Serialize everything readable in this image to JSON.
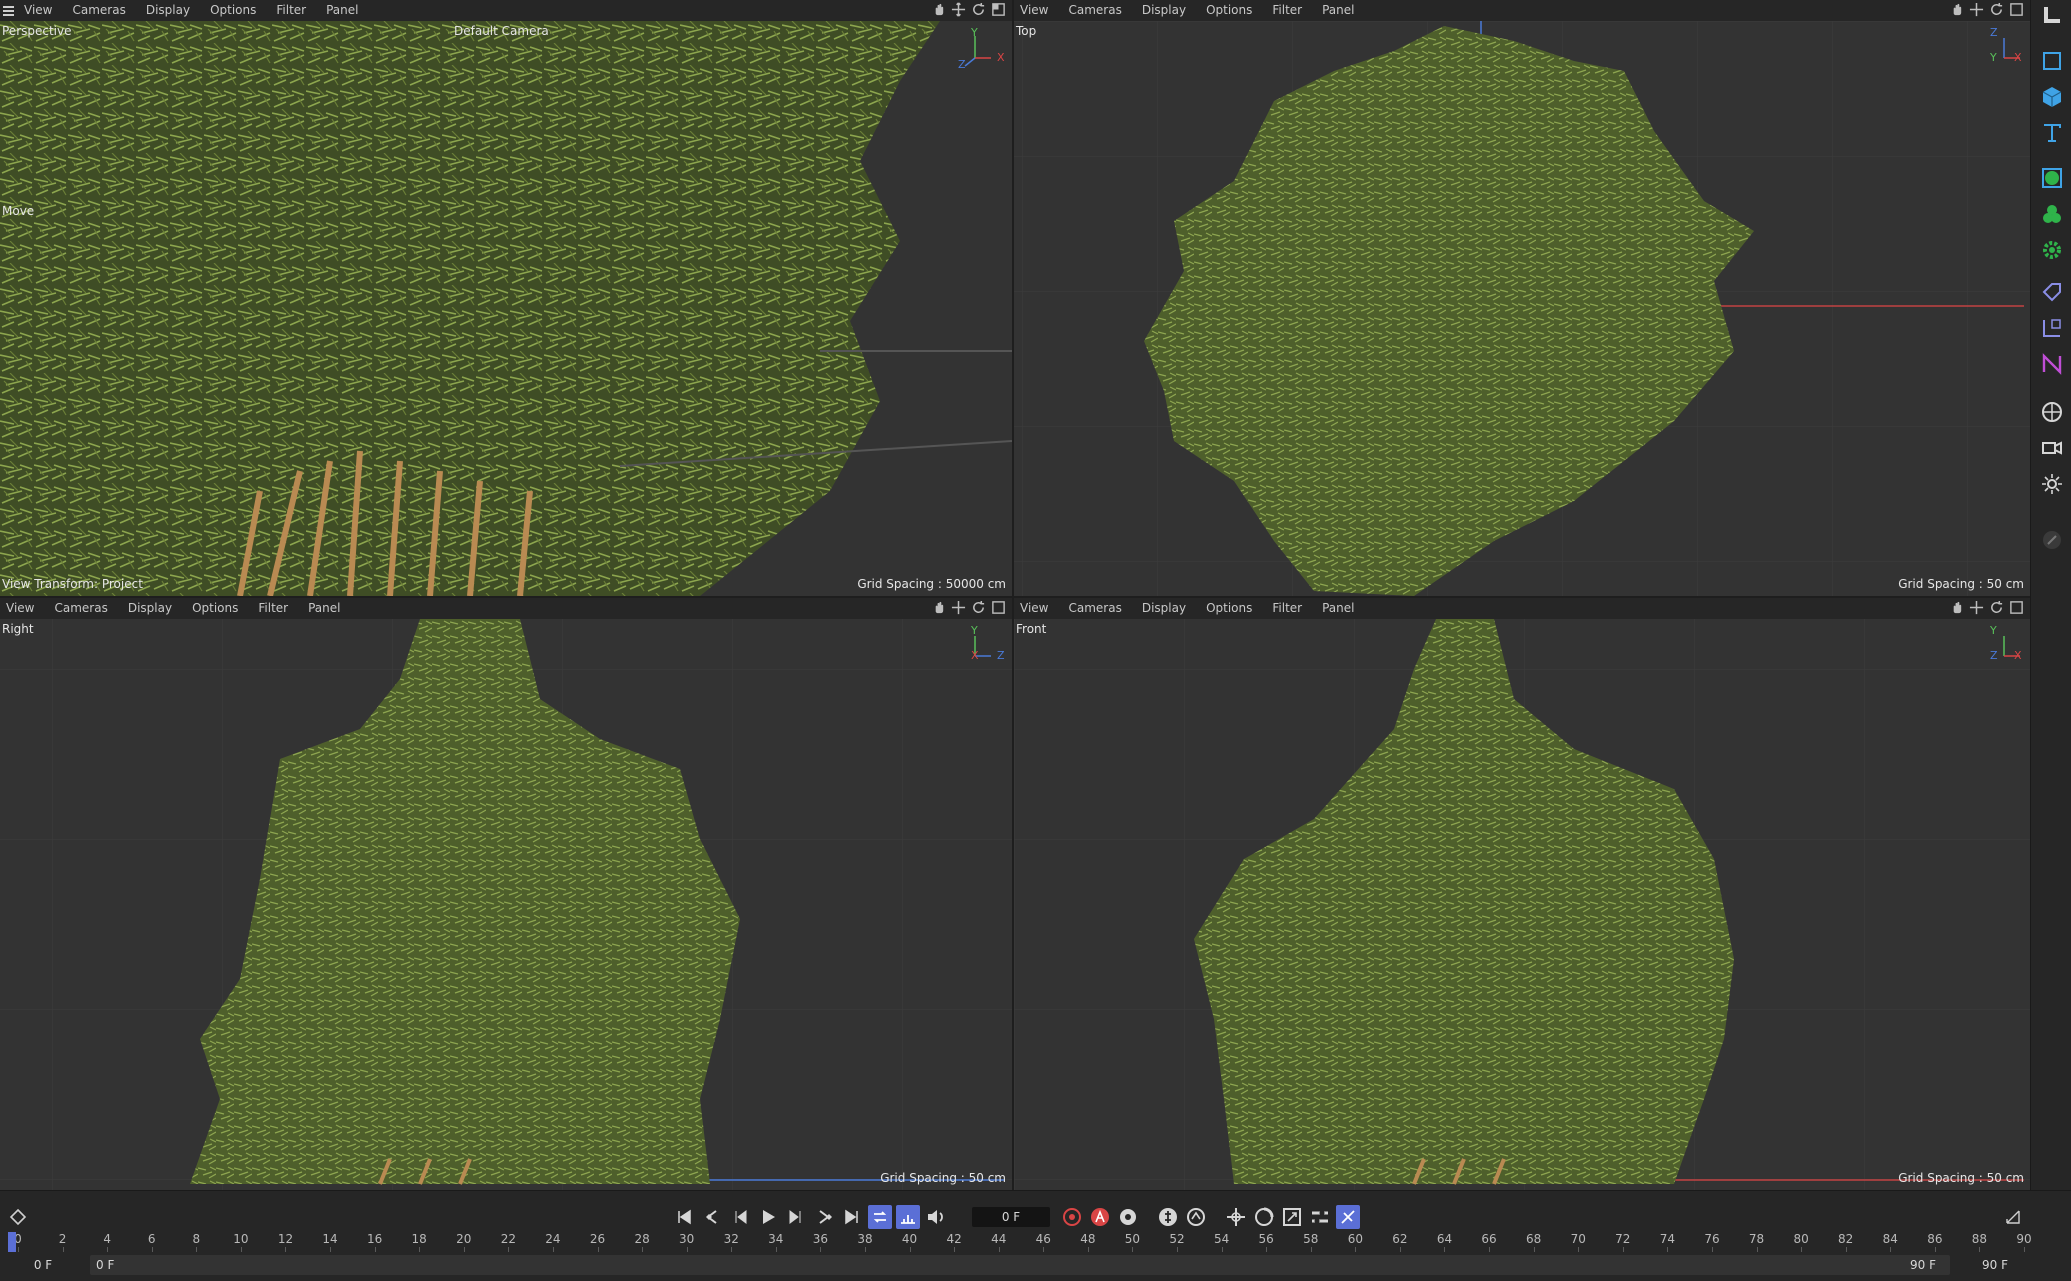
{
  "viewport_menu": [
    "View",
    "Cameras",
    "Display",
    "Options",
    "Filter",
    "Panel"
  ],
  "viewports": {
    "perspective": {
      "name": "Perspective",
      "camera": "Default Camera",
      "tool": "Move",
      "view_transform": "View Transform: Project",
      "grid_spacing": "Grid Spacing : 50000 cm",
      "axis": [
        "Y",
        "X",
        "Z"
      ]
    },
    "top": {
      "name": "Top",
      "grid_spacing": "Grid Spacing : 50 cm",
      "axis": [
        "Z",
        "X",
        "Y"
      ]
    },
    "right": {
      "name": "Right",
      "grid_spacing": "Grid Spacing : 50 cm",
      "axis": [
        "Y",
        "X",
        "Z"
      ]
    },
    "front": {
      "name": "Front",
      "grid_spacing": "Grid Spacing : 50 cm",
      "axis": [
        "Y",
        "Z",
        "X"
      ]
    }
  },
  "toolbar_icons": [
    "layout-icon",
    "cube-outline-icon",
    "cube-icon",
    "text-icon",
    "generator-icon",
    "mograph-icon",
    "deformer-icon",
    "tag-icon",
    "scene-icon",
    "effector-icon",
    "field-icon",
    "camera-icon",
    "light-icon",
    "sketch-icon"
  ],
  "timeline": {
    "current_frame": "0 F",
    "start_frame": "0 F",
    "start_frame_range": "0 F",
    "end_frame_range": "90 F",
    "end_frame": "90 F",
    "ruler_ticks": [
      "0",
      "2",
      "4",
      "6",
      "8",
      "10",
      "12",
      "14",
      "16",
      "18",
      "20",
      "22",
      "24",
      "26",
      "28",
      "30",
      "32",
      "34",
      "36",
      "38",
      "40",
      "42",
      "44",
      "46",
      "48",
      "50",
      "52",
      "54",
      "56",
      "58",
      "60",
      "62",
      "64",
      "66",
      "68",
      "70",
      "72",
      "74",
      "76",
      "78",
      "80",
      "82",
      "84",
      "86",
      "88",
      "90"
    ]
  },
  "colors": {
    "viewport_bg": "#333333",
    "bar_bg": "#262626",
    "foliage": "#6f8a3a",
    "accent_blue": "#5b6fd6",
    "axis_x": "#d94545",
    "axis_y": "#59c05a",
    "axis_z": "#4a7ad8"
  }
}
